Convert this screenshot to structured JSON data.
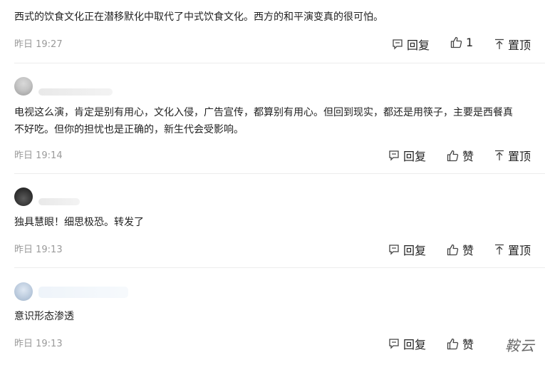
{
  "comments": [
    {
      "lines": [
        "西式的饮食文化正在潜移默化中取代了中式饮食文化。西方的和平演变真的很可怕。"
      ],
      "time": "昨日 19:27",
      "reply_label": "回复",
      "like_label": "1",
      "top_label": "置顶"
    },
    {
      "lines": [
        "电视这么演，肯定是别有用心，文化入侵，广告宣传，都算别有用心。但回到现实，都还是用筷子，主要是西餐真",
        "不好吃。但你的担忧也是正确的，新生代会受影响。"
      ],
      "time": "昨日 19:14",
      "reply_label": "回复",
      "like_label": "赞",
      "top_label": "置顶"
    },
    {
      "lines": [
        "独具慧眼！细思极恐。转发了"
      ],
      "time": "昨日 19:13",
      "reply_label": "回复",
      "like_label": "赞",
      "top_label": "置顶"
    },
    {
      "lines": [
        "意识形态渗透"
      ],
      "time": "昨日 19:13",
      "reply_label": "回复",
      "like_label": "赞",
      "top_label": ""
    }
  ],
  "watermark": "鞍云",
  "icons": {
    "reply": "comment-icon",
    "like": "thumbs-up-icon",
    "top": "pin-top-icon"
  }
}
